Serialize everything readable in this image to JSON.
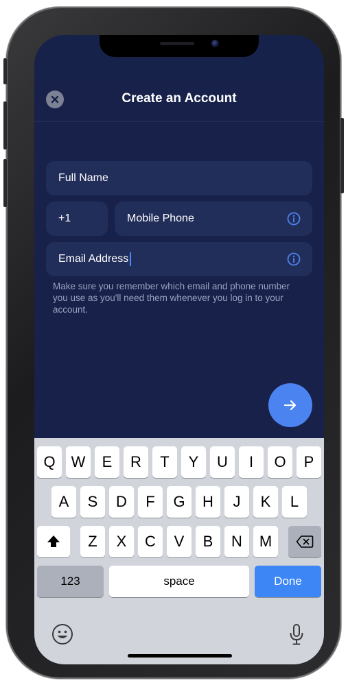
{
  "sheet": {
    "title": "Create an Account",
    "close_icon": "close-icon"
  },
  "form": {
    "full_name_placeholder": "Full Name",
    "country_code": "+1",
    "mobile_phone_placeholder": "Mobile Phone",
    "email_value": "Email Address",
    "hint": "Make sure you remember which email and phone number you use as you'll need them whenever you log in to your account."
  },
  "next_button": {
    "icon": "arrow-right-icon"
  },
  "keyboard": {
    "row1": [
      "Q",
      "W",
      "E",
      "R",
      "T",
      "Y",
      "U",
      "I",
      "O",
      "P"
    ],
    "row2": [
      "A",
      "S",
      "D",
      "F",
      "G",
      "H",
      "J",
      "K",
      "L"
    ],
    "row3": [
      "Z",
      "X",
      "C",
      "V",
      "B",
      "N",
      "M"
    ],
    "numbers_label": "123",
    "space_label": "space",
    "done_label": "Done",
    "shift_icon": "shift-icon",
    "backspace_icon": "backspace-icon",
    "emoji_icon": "emoji-icon",
    "mic_icon": "microphone-icon"
  },
  "colors": {
    "background": "#16224a",
    "field": "#222e5a",
    "accent": "#4b83f0",
    "done_key": "#3c86f6"
  }
}
